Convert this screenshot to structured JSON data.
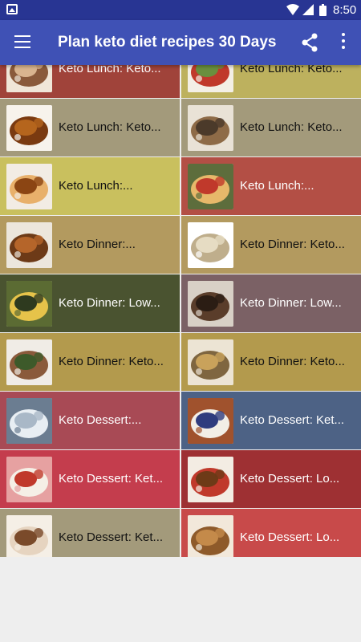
{
  "status_bar": {
    "time": "8:50"
  },
  "app_bar": {
    "title": "Plan keto diet recipes 30 Days"
  },
  "recipes": [
    {
      "label": "Keto Lunch: Keto...",
      "bg": "#a0433a",
      "text": "#ffffff"
    },
    {
      "label": "Keto Lunch: Keto...",
      "bg": "#bdb15e",
      "text": "#111111"
    },
    {
      "label": "Keto Lunch: Keto...",
      "bg": "#a39a7b",
      "text": "#111111"
    },
    {
      "label": "Keto Lunch: Keto...",
      "bg": "#a39a7b",
      "text": "#111111"
    },
    {
      "label": "Keto Lunch:...",
      "bg": "#c9c05e",
      "text": "#111111"
    },
    {
      "label": "Keto Lunch:...",
      "bg": "#b34f45",
      "text": "#ffffff"
    },
    {
      "label": "Keto Dinner:...",
      "bg": "#b39a5f",
      "text": "#111111"
    },
    {
      "label": "Keto Dinner: Keto...",
      "bg": "#b39a5f",
      "text": "#111111"
    },
    {
      "label": "Keto Dinner: Low...",
      "bg": "#4a5330",
      "text": "#ffffff"
    },
    {
      "label": "Keto Dinner: Low...",
      "bg": "#7b6165",
      "text": "#ffffff"
    },
    {
      "label": "Keto Dinner: Keto...",
      "bg": "#b39a4d",
      "text": "#111111"
    },
    {
      "label": "Keto Dinner: Keto...",
      "bg": "#b39a4d",
      "text": "#111111"
    },
    {
      "label": "Keto Dessert:...",
      "bg": "#a84a55",
      "text": "#ffffff"
    },
    {
      "label": "Keto Dessert: Ket...",
      "bg": "#4d6285",
      "text": "#ffffff"
    },
    {
      "label": "Keto Dessert: Ket...",
      "bg": "#c43d4d",
      "text": "#ffffff"
    },
    {
      "label": "Keto Dessert: Lo...",
      "bg": "#9e3033",
      "text": "#ffffff"
    },
    {
      "label": "Keto Dessert: Ket...",
      "bg": "#a39a7b",
      "text": "#111111"
    },
    {
      "label": "Keto Dessert: Lo...",
      "bg": "#c84a4a",
      "text": "#ffffff"
    }
  ],
  "thumb_palettes": [
    [
      "#d9b48f",
      "#8a5a3b",
      "#f0e6d8"
    ],
    [
      "#6a8f3e",
      "#c0392b",
      "#f3efe6"
    ],
    [
      "#b5651d",
      "#7a3a10",
      "#f7f3ec"
    ],
    [
      "#4b3a2a",
      "#8e6b47",
      "#e9e2d6"
    ],
    [
      "#8b4513",
      "#e8b06b",
      "#f2ece4"
    ],
    [
      "#c0392b",
      "#e7b86a",
      "#5d6d3c"
    ],
    [
      "#b5652a",
      "#6d3a17",
      "#ece6dc"
    ],
    [
      "#e6dcc3",
      "#bfae8c",
      "#ffffff"
    ],
    [
      "#2e3a1f",
      "#e6c34a",
      "#5b6b33"
    ],
    [
      "#2b1d14",
      "#5a3d2a",
      "#d8d0c6"
    ],
    [
      "#3d5a2a",
      "#8a5a3b",
      "#f0ece6"
    ],
    [
      "#c9a25b",
      "#7f6640",
      "#ece4d4"
    ],
    [
      "#a9b8c7",
      "#e8eef3",
      "#6b7d91"
    ],
    [
      "#2f3c7e",
      "#f2eee6",
      "#a0522d"
    ],
    [
      "#c0392b",
      "#f5efe6",
      "#e6a1a1"
    ],
    [
      "#6d3a17",
      "#c0392b",
      "#f3ece3"
    ],
    [
      "#7a4a2a",
      "#e6d4c0",
      "#f5efe6"
    ],
    [
      "#c48a4a",
      "#8e5a2a",
      "#f2e8da"
    ]
  ]
}
